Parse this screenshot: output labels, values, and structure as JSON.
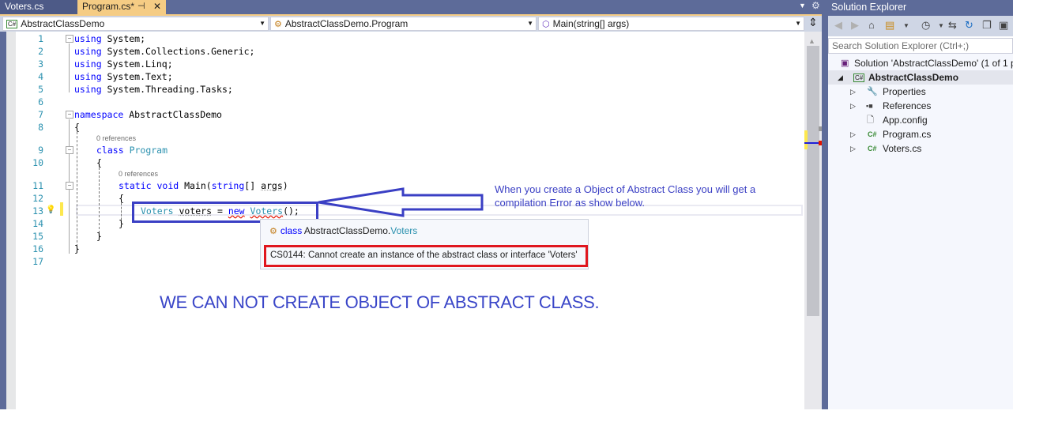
{
  "editor": {
    "tabs": [
      {
        "label": "Voters.cs",
        "active": false
      },
      {
        "label": "Program.cs*",
        "active": true,
        "pin_icon": "pin-icon",
        "close_icon": "close-icon"
      }
    ],
    "nav": {
      "project": "AbstractClassDemo",
      "class": "AbstractClassDemo.Program",
      "member": "Main(string[] args)"
    },
    "lines": [
      {
        "n": "1",
        "text": "using System;"
      },
      {
        "n": "2",
        "text": "using System.Collections.Generic;"
      },
      {
        "n": "3",
        "text": "using System.Linq;"
      },
      {
        "n": "4",
        "text": "using System.Text;"
      },
      {
        "n": "5",
        "text": "using System.Threading.Tasks;"
      },
      {
        "n": "6",
        "text": ""
      },
      {
        "n": "7",
        "text": "namespace AbstractClassDemo"
      },
      {
        "n": "8",
        "text": "{"
      },
      {
        "n": "9",
        "text": "class Program"
      },
      {
        "n": "10",
        "text": "{"
      },
      {
        "n": "11",
        "text": "static void Main(string[] args)"
      },
      {
        "n": "12",
        "text": "{"
      },
      {
        "n": "13",
        "text": "Voters voters = new Voters();"
      },
      {
        "n": "14",
        "text": "}"
      },
      {
        "n": "15",
        "text": "}"
      },
      {
        "n": "16",
        "text": "}"
      },
      {
        "n": "17",
        "text": ""
      }
    ],
    "codelens": [
      "0 references",
      "0 references"
    ],
    "quickinfo": {
      "signature_keyword": "class",
      "signature_namespace": "AbstractClassDemo.",
      "signature_type": "Voters",
      "error": "CS0144: Cannot create an instance of the abstract class or interface 'Voters'"
    },
    "annotation": "When you create a Object of Abstract Class you will get a compilation Error as show below.",
    "headline": "WE CAN NOT CREATE OBJECT OF ABSTRACT CLASS.",
    "colors": {
      "annotation_blue": "#3a3fc4",
      "error_red": "#e0161e",
      "keyword": "#0000ff",
      "type": "#2b91af",
      "active_tab": "#f5cc84",
      "frame": "#5d6b99"
    }
  },
  "solution_explorer": {
    "title": "Solution Explorer",
    "search_placeholder": "Search Solution Explorer (Ctrl+;)",
    "toolbar_icons": [
      "back-icon",
      "forward-icon",
      "home-icon",
      "switch-views-icon",
      "pending-changes-icon",
      "sync-icon",
      "refresh-icon",
      "collapse-all-icon",
      "show-all-files-icon"
    ],
    "tree": [
      {
        "label": "Solution 'AbstractClassDemo' (1 of 1 p",
        "icon": "solution-icon"
      },
      {
        "label": "AbstractClassDemo",
        "icon": "csharp-project-icon",
        "expanded": true,
        "selected": true
      },
      {
        "label": "Properties",
        "icon": "wrench-icon"
      },
      {
        "label": "References",
        "icon": "references-icon"
      },
      {
        "label": "App.config",
        "icon": "config-file-icon"
      },
      {
        "label": "Program.cs",
        "icon": "csharp-file-icon"
      },
      {
        "label": "Voters.cs",
        "icon": "csharp-file-icon"
      }
    ]
  }
}
